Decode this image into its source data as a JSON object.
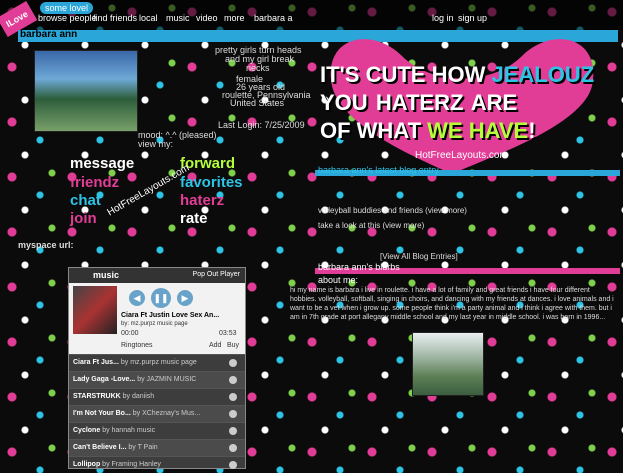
{
  "topbar": {
    "badge": "ILove",
    "tab": "some lovel",
    "nav": [
      "browse people",
      "find friends",
      "local",
      "music",
      "video",
      "more",
      "barbara a",
      "log in",
      "sign up"
    ]
  },
  "profile": {
    "name": "barbara ann",
    "quote_lines": [
      "pretty girls turn heads",
      "and my girl break",
      "necks",
      "female",
      "26 years old",
      "roulette, Pennsylvania",
      "United States"
    ],
    "mood": "mood: ^.^ (pleased)",
    "view_my": "view my:",
    "last_login": "Last Login: 7/25/2009",
    "myspace_url_label": "myspace url:"
  },
  "contact": {
    "message": "message",
    "forward": "forward",
    "friendz": "friendz",
    "favorites": "favorites",
    "chat": "chat",
    "haterz": "haterz",
    "join": "join",
    "rate": "rate",
    "watermark": "HotFreeLayouts.com"
  },
  "banner": {
    "line1_a": "IT'S CUTE HOW",
    "line1_b": "JEALOUZ",
    "line2_a": "YOU",
    "line2_b": "HATERZ",
    "line2_c": "ARE",
    "line3_a": "OF WHAT",
    "line3_b": "WE HAVE",
    "line3_c": "!",
    "site": "HotFreeLayouts.com"
  },
  "blog": {
    "header": "barbara ann's latest blog entry",
    "entries": [
      "volleyball buddies and friends (view more)",
      "take a look at this (view more)"
    ],
    "view_all": "[View All Blog Entries]"
  },
  "blurbs": {
    "header": "barbara ann's blurbs",
    "about": "about me:",
    "body": "hi my name is barbara i live in roulette. i have a lot of family and great friends i have four different hobbies. volleyball, softball, singing in choirs, and dancing with my friends at dances. i love animals and i want to be a vet when i grow up. some people think i'm a party animal and i think i agree with them. but i am in 7th grade at port allegany middle school and my last year in middle school. i was born in 1996..."
  },
  "player": {
    "brand": "music",
    "popout": "Pop Out Player",
    "now_title": "Ciara Ft Justin Love Sex An...",
    "now_artist": "by: mz.purpz music page",
    "time_elapsed": "00:00",
    "time_total": "03:53",
    "ringtones": "Ringtones",
    "add": "Add",
    "buy": "Buy",
    "tracks": [
      {
        "title": "Ciara Ft Jus...",
        "by": "by mz.purpz music page"
      },
      {
        "title": "Lady Gaga -Love...",
        "by": "by JAZMIN MUSIC"
      },
      {
        "title": "STARSTRUKK",
        "by": "by daniish"
      },
      {
        "title": "I'm Not Your Bo...",
        "by": "by XCheznay's Mus..."
      },
      {
        "title": "Cyclone",
        "by": "by hannah music"
      },
      {
        "title": "Can't Believe I...",
        "by": "by T Pain"
      },
      {
        "title": "Lollipop",
        "by": "by Framing Hanley"
      }
    ]
  }
}
